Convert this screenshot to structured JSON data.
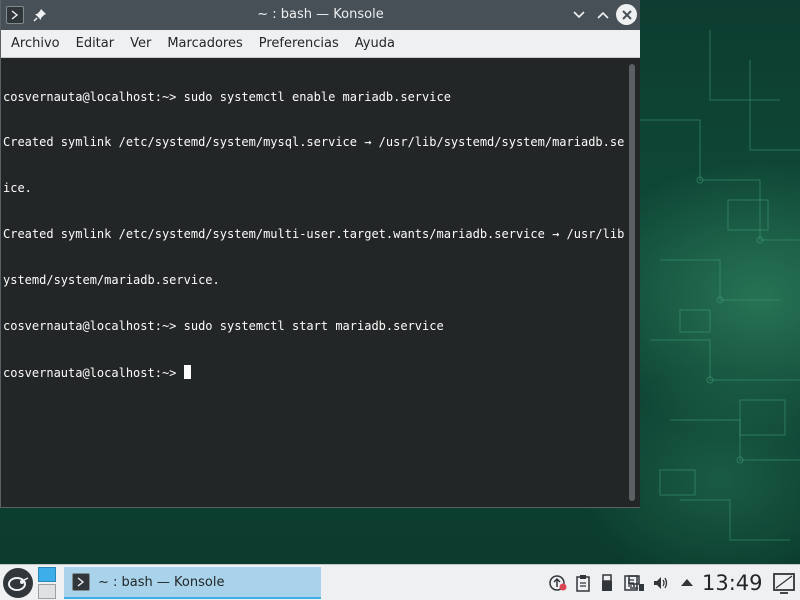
{
  "window": {
    "title": "~ : bash — Konsole"
  },
  "menubar": {
    "items": [
      "Archivo",
      "Editar",
      "Ver",
      "Marcadores",
      "Preferencias",
      "Ayuda"
    ]
  },
  "terminal": {
    "lines": [
      "cosvernauta@localhost:~> sudo systemctl enable mariadb.service",
      "Created symlink /etc/systemd/system/mysql.service → /usr/lib/systemd/system/mariadb.serv",
      "ice.",
      "Created symlink /etc/systemd/system/multi-user.target.wants/mariadb.service → /usr/lib/s",
      "ystemd/system/mariadb.service.",
      "cosvernauta@localhost:~> sudo systemctl start mariadb.service",
      "cosvernauta@localhost:~> "
    ]
  },
  "taskbar": {
    "task_label": "~ : bash — Konsole",
    "clock": "13:49"
  },
  "icons": {
    "app": "konsole-icon",
    "pin": "pin-icon",
    "minimize": "chevron-down-icon",
    "maximize": "chevron-up-icon",
    "close": "close-icon",
    "launcher": "opensuse-launcher-icon",
    "tray": [
      "updates-icon",
      "clipboard-icon",
      "usb-icon",
      "notes-icon",
      "network-icon",
      "volume-icon",
      "tray-expand-icon"
    ],
    "show_desktop": "show-desktop-icon"
  },
  "colors": {
    "accent": "#3daee9",
    "titlebar": "#475057",
    "terminal_bg": "#232627",
    "terminal_fg": "#fcfcfc"
  }
}
